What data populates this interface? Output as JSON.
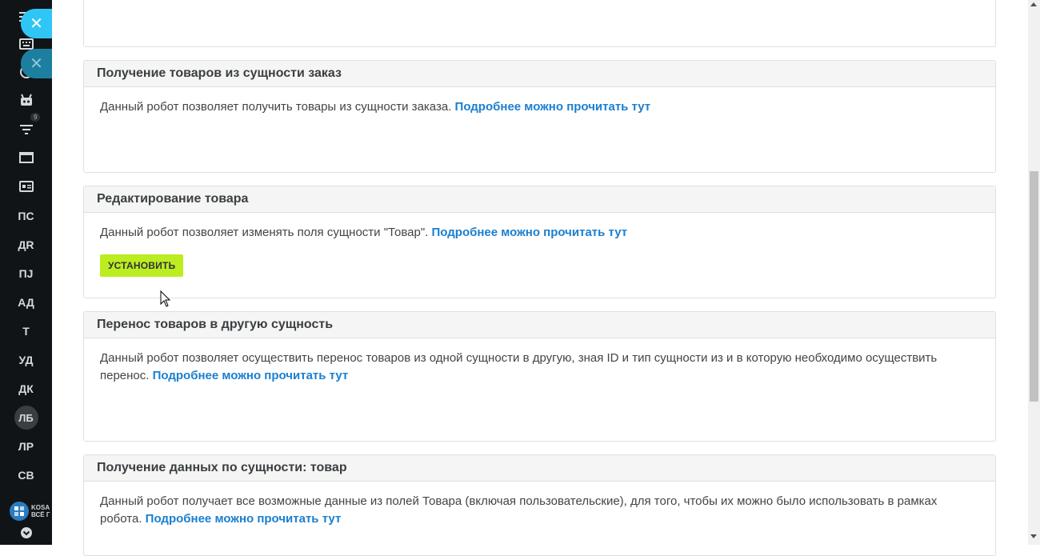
{
  "sidebar": {
    "items": [
      {
        "type": "icon",
        "icon": "keyboard-icon"
      },
      {
        "type": "icon",
        "icon": "clock-icon"
      },
      {
        "type": "icon",
        "icon": "robot-icon"
      },
      {
        "type": "icon",
        "icon": "filter-icon",
        "badge": "9"
      },
      {
        "type": "icon",
        "icon": "window-icon"
      },
      {
        "type": "icon",
        "icon": "id-card-icon"
      },
      {
        "type": "text",
        "label": "ПС"
      },
      {
        "type": "text",
        "label": "ДR"
      },
      {
        "type": "text",
        "label": "ПJ"
      },
      {
        "type": "text",
        "label": "АД"
      },
      {
        "type": "text",
        "label": "Т"
      },
      {
        "type": "text",
        "label": "УД"
      },
      {
        "type": "text",
        "label": "ДК"
      },
      {
        "type": "avatar",
        "label": "ЛБ"
      },
      {
        "type": "text",
        "label": "ЛР"
      },
      {
        "type": "text",
        "label": "СВ"
      }
    ],
    "logo_text": "KOSA ВСЁ Г",
    "close_icon": "close-icon"
  },
  "cards": [
    {
      "title": "Получение товаров из сущности заказ",
      "text": "Данный робот позволяет получить товары из сущности заказа.",
      "link": "Подробнее можно прочитать тут"
    },
    {
      "title": "Редактирование товара",
      "text": "Данный робот позволяет изменять поля сущности \"Товар\".",
      "link": "Подробнее можно прочитать тут",
      "button": "УСТАНОВИТЬ"
    },
    {
      "title": "Перенос товаров в другую сущность",
      "text": "Данный робот позволяет осуществить перенос товаров из одной сущности в другую, зная ID и тип сущности из и в которую необходимо осуществить перенос.",
      "link": "Подробнее можно прочитать тут"
    },
    {
      "title": "Получение данных по сущности: товар",
      "text": "Данный робот получает все возможные данные из полей Товара (включая пользовательские), для того, чтобы их можно было использовать в рамках робота.",
      "link": "Подробнее можно прочитать тут"
    }
  ],
  "colors": {
    "accent_link": "#1a7fd0",
    "install_button": "#bbed21",
    "sidebar_bg": "#111417",
    "close_button": "#2fc6f6"
  }
}
